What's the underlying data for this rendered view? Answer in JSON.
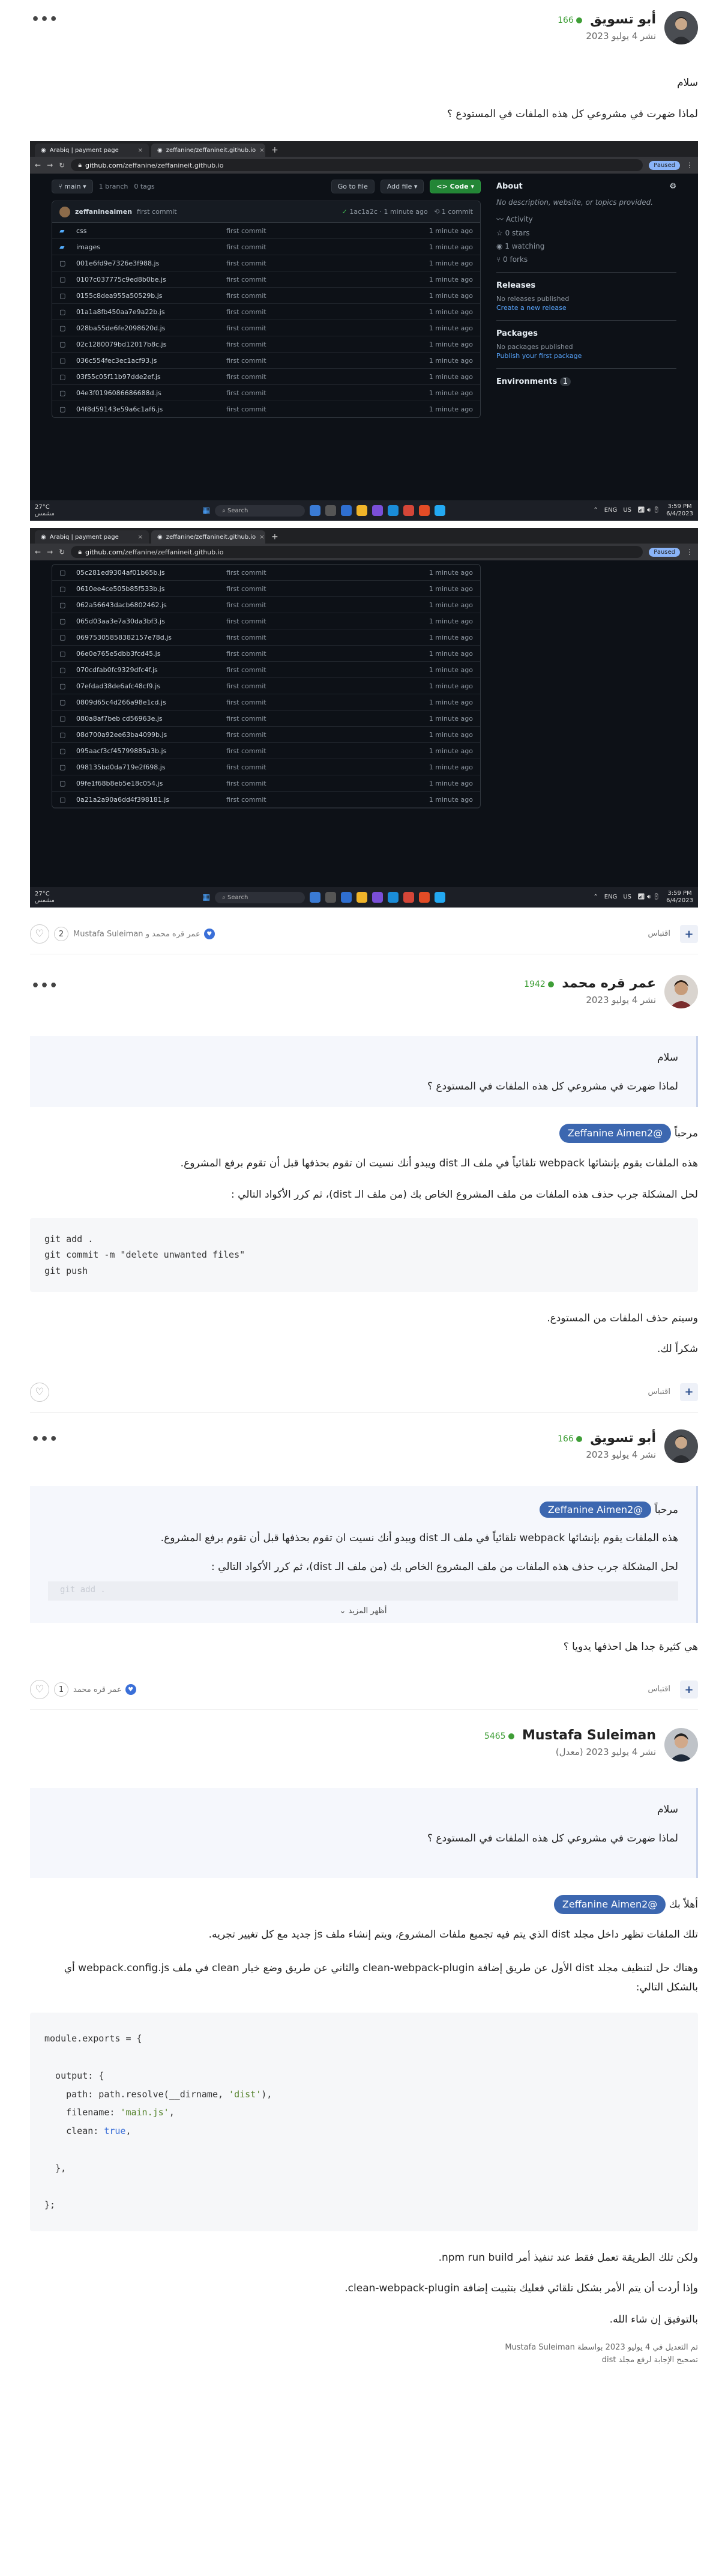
{
  "posts": [
    {
      "author": "أبو تسويق",
      "reputation": "166",
      "date": "نشر 4 يوليو 2023",
      "paragraphs": [
        "سلام",
        "لماذا ضهرت في مشروعي كل هذه الملفات في المستودع ؟"
      ],
      "footer": {
        "quote": "اقتباس",
        "like_count": "2",
        "likers": "عمر قره محمد و Mustafa Suleiman"
      }
    },
    {
      "author": "عمر قره محمد",
      "reputation": "1942",
      "date": "نشر 4 يوليو 2023",
      "quote_paragraphs": [
        "سلام",
        "لماذا ضهرت في مشروعي كل هذه الملفات في المستودع ؟"
      ],
      "greeting": "مرحباً",
      "mention": "@Zeffanine Aimen2",
      "paragraphs": [
        "هذه الملفات يقوم بإنشائها webpack تلقائياً في ملف الـ dist ويبدو أنك نسيت ان تقوم بحذفها قبل أن تقوم برفع المشروع.",
        "لحل المشكلة جرب حذف هذه الملفات من ملف المشروع الخاص بك (من ملف الـ dist)، ثم كرر الأكواد التالي :"
      ],
      "code": [
        "git add .",
        "git commit -m \"delete unwanted files\"",
        "git push"
      ],
      "after_code": [
        "وسيتم حذف الملفات من المستودع.",
        "شكراً لك."
      ],
      "footer": {
        "quote": "اقتباس"
      }
    },
    {
      "author": "أبو تسويق",
      "reputation": "166",
      "date": "نشر 4 يوليو 2023",
      "quote_greeting": "مرحباً",
      "quote_mention": "@Zeffanine Aimen2",
      "quote_paragraphs": [
        "هذه الملفات يقوم بإنشائها webpack تلقائياً في ملف الـ dist ويبدو أنك نسيت ان تقوم بحذفها قبل أن تقوم برفع المشروع.",
        "لحل المشكلة جرب حذف هذه الملفات من ملف المشروع الخاص بك (من ملف الـ dist)، ثم كرر الأكواد التالي :"
      ],
      "quote_code_fragment": "git add .",
      "read_more": "أظهر المزيد",
      "paragraphs": [
        "هي كثيرة جدا هل احذفها يدويا ؟"
      ],
      "footer": {
        "quote": "اقتباس",
        "like_count": "1",
        "likers": "عمر قره محمد"
      }
    },
    {
      "author": "Mustafa Suleiman",
      "reputation": "5465",
      "date": "نشر 4 يوليو 2023 (معدل)",
      "quote_paragraphs": [
        "سلام",
        "لماذا ضهرت في مشروعي كل هذه الملفات في المستودع ؟"
      ],
      "greeting": "أهلاً بك",
      "mention": "@Zeffanine Aimen2",
      "paragraphs": [
        "تلك الملفات تظهر داخل مجلد dist الذي يتم فيه تجميع ملفات المشروع، ويتم إنشاء ملف js جديد مع كل تغيير تجريه.",
        "وهناك حل لتنظيف مجلد dist الأول عن طريق إضافة clean-webpack-plugin والثاني عن طريق وضع خيار clean في ملف webpack.config.js أي بالشكل التالي:"
      ],
      "after_code": [
        "ولكن تلك الطريقة تعمل فقط عند تنفيذ أمر npm run build.",
        "وإذا أردت أن يتم الأمر بشكل تلقائي فعليك بتثبيت إضافة clean-webpack-plugin.",
        "بالتوفيق إن شاء الله."
      ],
      "edited": "تم التعديل في 4 يوليو 2023 بواسطة Mustafa Suleiman",
      "edited_reason": "تصحيح الإجابة لرفع مجلد dist"
    }
  ],
  "screenshot1": {
    "tabs": [
      "Arabiq | payment page",
      "zeffanine/zeffanineit.github.io"
    ],
    "url_host": "github.com",
    "url_path": "/zeffanine/zeffanineit.github.io",
    "paused": "Paused",
    "branch": "main",
    "branches": "1 branch",
    "tags": "0 tags",
    "go_to_file": "Go to file",
    "add_file": "Add file",
    "code_btn": "Code",
    "commit_user": "zeffanineaimen",
    "commit_msg": "first commit",
    "commit_hash": "1ac1a2c · 1 minute ago",
    "commit_count": "1 commit",
    "files": [
      {
        "name": "css",
        "type": "folder"
      },
      {
        "name": "images",
        "type": "folder"
      },
      {
        "name": "001e6fd9e7326e3f988.js",
        "type": "file"
      },
      {
        "name": "0107c037775c9ed8b0be.js",
        "type": "file"
      },
      {
        "name": "0155c8dea955a50529b.js",
        "type": "file"
      },
      {
        "name": "01a1a8fb450aa7e9a22b.js",
        "type": "file"
      },
      {
        "name": "028ba55de6fe2098620d.js",
        "type": "file"
      },
      {
        "name": "02c1280079bd12017b8c.js",
        "type": "file"
      },
      {
        "name": "036c554fec3ec1acf93.js",
        "type": "file"
      },
      {
        "name": "03f55c05f11b97dde2ef.js",
        "type": "file"
      },
      {
        "name": "04e3f0196086686688d.js",
        "type": "file"
      },
      {
        "name": "04f8d59143e59a6c1af6.js",
        "type": "file"
      }
    ],
    "row_msg": "first commit",
    "row_time": "1 minute ago",
    "about_title": "About",
    "about_desc": "No description, website, or topics provided.",
    "about_items": [
      "Activity",
      "0 stars",
      "1 watching",
      "0 forks"
    ],
    "releases_title": "Releases",
    "releases_none": "No releases published",
    "releases_link": "Create a new release",
    "packages_title": "Packages",
    "packages_none": "No packages published",
    "packages_link": "Publish your first package",
    "environments_title": "Environments",
    "environments_count": "1",
    "weather_temp": "27°C",
    "weather_desc": "مشمس",
    "search": "Search",
    "lang": "ENG",
    "region": "US",
    "time": "3:59 PM",
    "date": "6/4/2023"
  },
  "screenshot2": {
    "files": [
      "05c281ed9304af01b65b.js",
      "0610ee4ce505b85f533b.js",
      "062a56643dacb6802462.js",
      "065d03aa3e7a30da3bf3.js",
      "06975305858382157e78d.js",
      "06e0e765e5dbb3fcd45.js",
      "070cdfab0fc9329dfc4f.js",
      "07efdad38de6afc48cf9.js",
      "0809d65c4d266a98e1cd.js",
      "080a8af7beb cd56963e.js",
      "08d700a92ee63ba4099b.js",
      "095aacf3cf45799885a3b.js",
      "098135bd0da719e2f698.js",
      "09fe1f68b8eb5e18c054.js",
      "0a21a2a90a6dd4f398181.js"
    ],
    "time": "3:59 PM",
    "date": "6/4/2023"
  },
  "code_block_2": {
    "l1": "module.exports = {",
    "l2": "  output: {",
    "l3a": "    path: path.resolve(__dirname, ",
    "l3b": "'dist'",
    "l3c": "),",
    "l4a": "    filename: ",
    "l4b": "'main.js'",
    "l4c": ",",
    "l5a": "    clean: ",
    "l5b": "true",
    "l5c": ",",
    "l6": "  },",
    "l7": "};"
  }
}
